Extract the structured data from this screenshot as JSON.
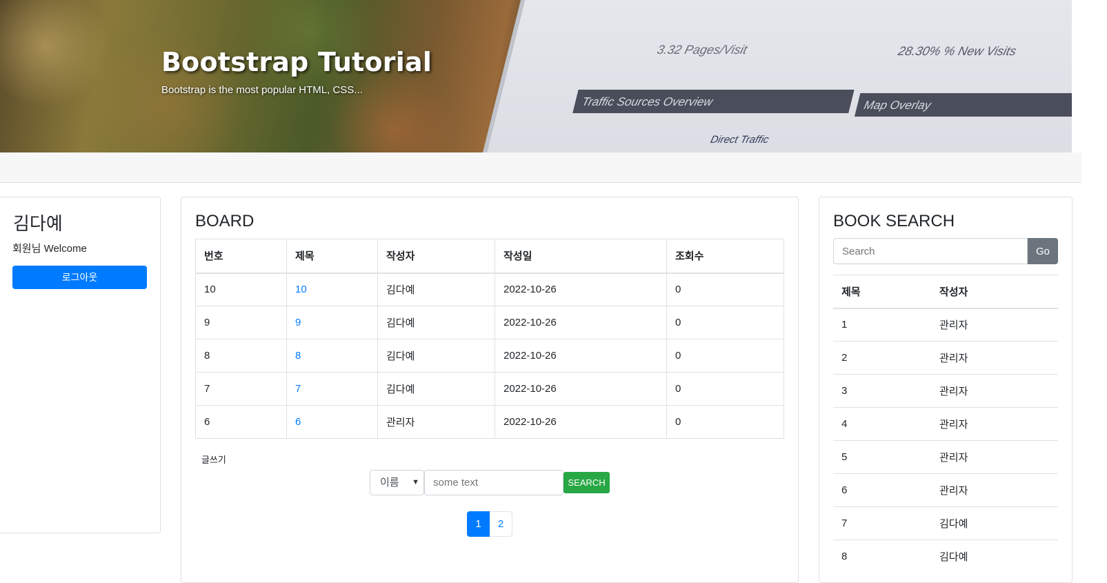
{
  "hero": {
    "title": "Bootstrap Tutorial",
    "subtitle": "Bootstrap is the most popular HTML, CSS...",
    "screen_texts": [
      "3.32 Pages/Visit",
      "Traffic Sources Overview",
      "Map Overlay",
      "Direct Traffic",
      "28.30% % New Visits"
    ]
  },
  "user": {
    "name": "김다예",
    "welcome": "회원님 Welcome",
    "logout_label": "로그아웃"
  },
  "board": {
    "title": "BOARD",
    "columns": [
      "번호",
      "제목",
      "작성자",
      "작성일",
      "조회수"
    ],
    "rows": [
      [
        "10",
        "10",
        "김다예",
        "2022-10-26",
        "0"
      ],
      [
        "9",
        "9",
        "김다예",
        "2022-10-26",
        "0"
      ],
      [
        "8",
        "8",
        "김다예",
        "2022-10-26",
        "0"
      ],
      [
        "7",
        "7",
        "김다예",
        "2022-10-26",
        "0"
      ],
      [
        "6",
        "6",
        "관리자",
        "2022-10-26",
        "0"
      ]
    ],
    "write_label": "글쓰기",
    "search": {
      "select_value": "이름",
      "placeholder": "some text",
      "button_label": "SEARCH"
    },
    "pages": [
      "1",
      "2"
    ],
    "active_page": "1"
  },
  "book_search": {
    "title": "BOOK SEARCH",
    "placeholder": "Search",
    "go_label": "Go",
    "columns": [
      "제목",
      "작성자"
    ],
    "rows": [
      [
        "1",
        "관리자"
      ],
      [
        "2",
        "관리자"
      ],
      [
        "3",
        "관리자"
      ],
      [
        "4",
        "관리자"
      ],
      [
        "5",
        "관리자"
      ],
      [
        "6",
        "관리자"
      ],
      [
        "7",
        "김다예"
      ],
      [
        "8",
        "김다예"
      ]
    ]
  },
  "colors": {
    "primary": "#007bff",
    "success": "#28a745",
    "secondary": "#6c757d"
  }
}
